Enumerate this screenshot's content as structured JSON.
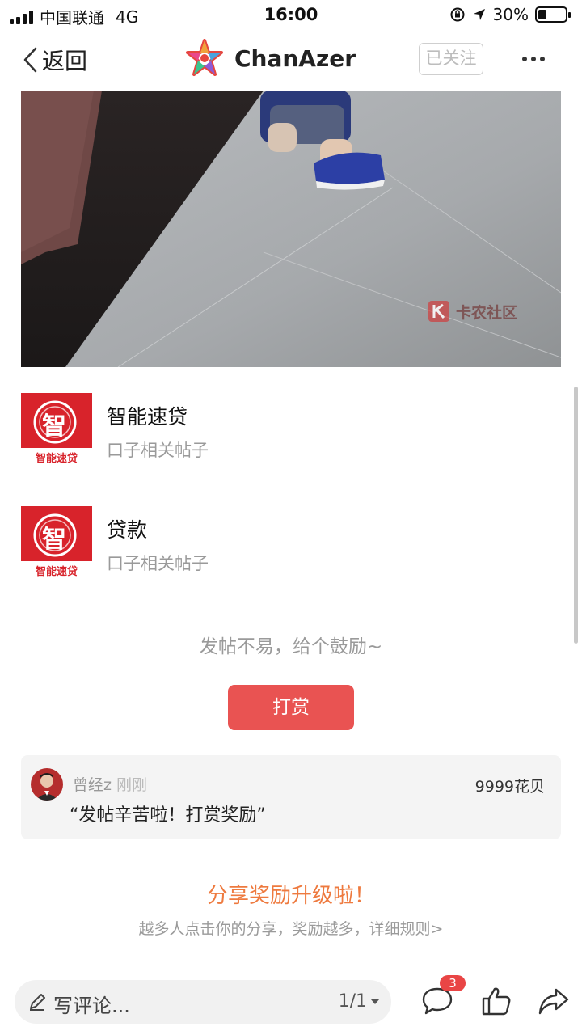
{
  "status_bar": {
    "carrier": "中国联通",
    "network": "4G",
    "time": "16:00",
    "battery": "30%",
    "battery_level": 0.3
  },
  "nav": {
    "back_label": "返回",
    "app_name": "ChanAzer",
    "follow_label": "已关注",
    "more_icon": "more-dots-icon"
  },
  "photo": {
    "watermark_text": "卡农社区"
  },
  "related": [
    {
      "title": "智能速贷",
      "subtitle": "口子相关帖子",
      "icon_text": "智",
      "icon_caption": "智能速贷"
    },
    {
      "title": "贷款",
      "subtitle": "口子相关帖子",
      "icon_text": "智",
      "icon_caption": "智能速贷"
    }
  ],
  "reward": {
    "encourage_text": "发帖不易，给个鼓励~",
    "button_label": "打赏",
    "record": {
      "user": "曾经z",
      "time": "刚刚",
      "amount": "9999花贝",
      "message": "“发帖辛苦啦！打赏奖励”"
    }
  },
  "share": {
    "title": "分享奖励升级啦！",
    "subtitle": "越多人点击你的分享，奖励越多，详细规则>"
  },
  "bottom_bar": {
    "comment_placeholder": "写评论...",
    "pager": "1/1",
    "comment_count": "3"
  },
  "colors": {
    "accent_red": "#e95352",
    "share_orange": "#ee7a3f",
    "badge_red": "#e94545"
  }
}
